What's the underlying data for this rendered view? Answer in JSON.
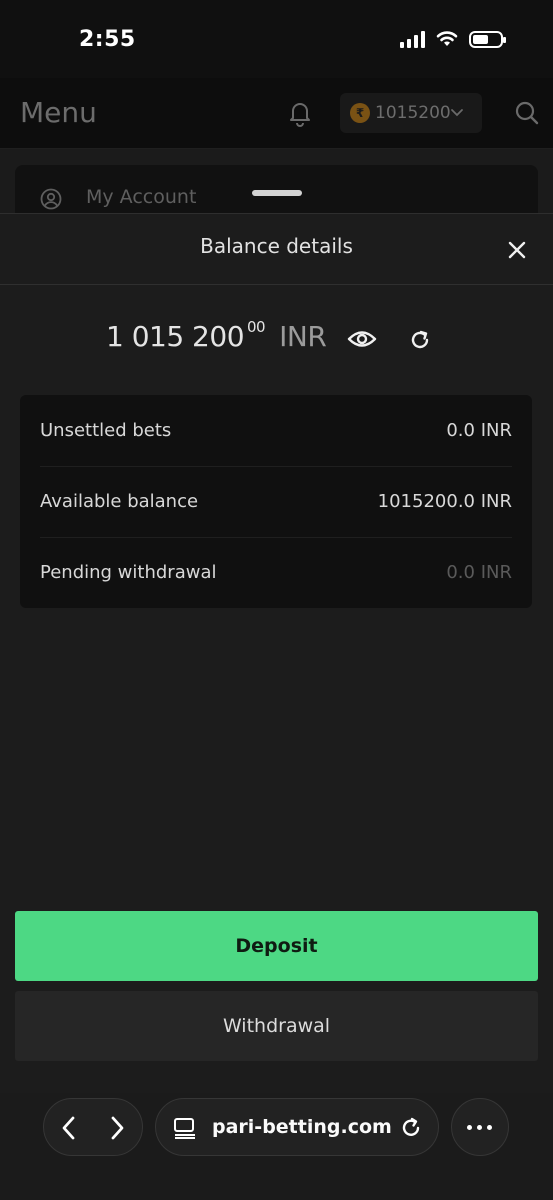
{
  "status_bar": {
    "time": "2:55"
  },
  "background_app": {
    "title": "Menu",
    "balance_currency_symbol": "₹",
    "balance_amount": "1015200",
    "account_item": "My Account"
  },
  "sheet": {
    "title": "Balance details",
    "balance": {
      "integer": "1 015 200",
      "decimals": "00",
      "currency": "INR"
    },
    "rows": [
      {
        "label": "Unsettled bets",
        "value": "0.0 INR",
        "muted": false
      },
      {
        "label": "Available balance",
        "value": "1015200.0 INR",
        "muted": false
      },
      {
        "label": "Pending withdrawal",
        "value": "0.0 INR",
        "muted": true
      }
    ],
    "deposit_label": "Deposit",
    "withdrawal_label": "Withdrawal"
  },
  "browser": {
    "url": "pari-betting.com"
  },
  "colors": {
    "accent_green": "#4dd884",
    "background": "#1b1b1b",
    "card": "#101010"
  },
  "icons": {
    "bell": "bell-icon",
    "search": "search-icon",
    "account": "user-circle-icon",
    "close": "close-icon",
    "eye": "eye-icon",
    "refresh": "refresh-icon",
    "back": "chevron-left-icon",
    "forward": "chevron-right-icon",
    "tabs": "tabs-icon",
    "reload": "reload-icon",
    "more": "more-icon"
  }
}
